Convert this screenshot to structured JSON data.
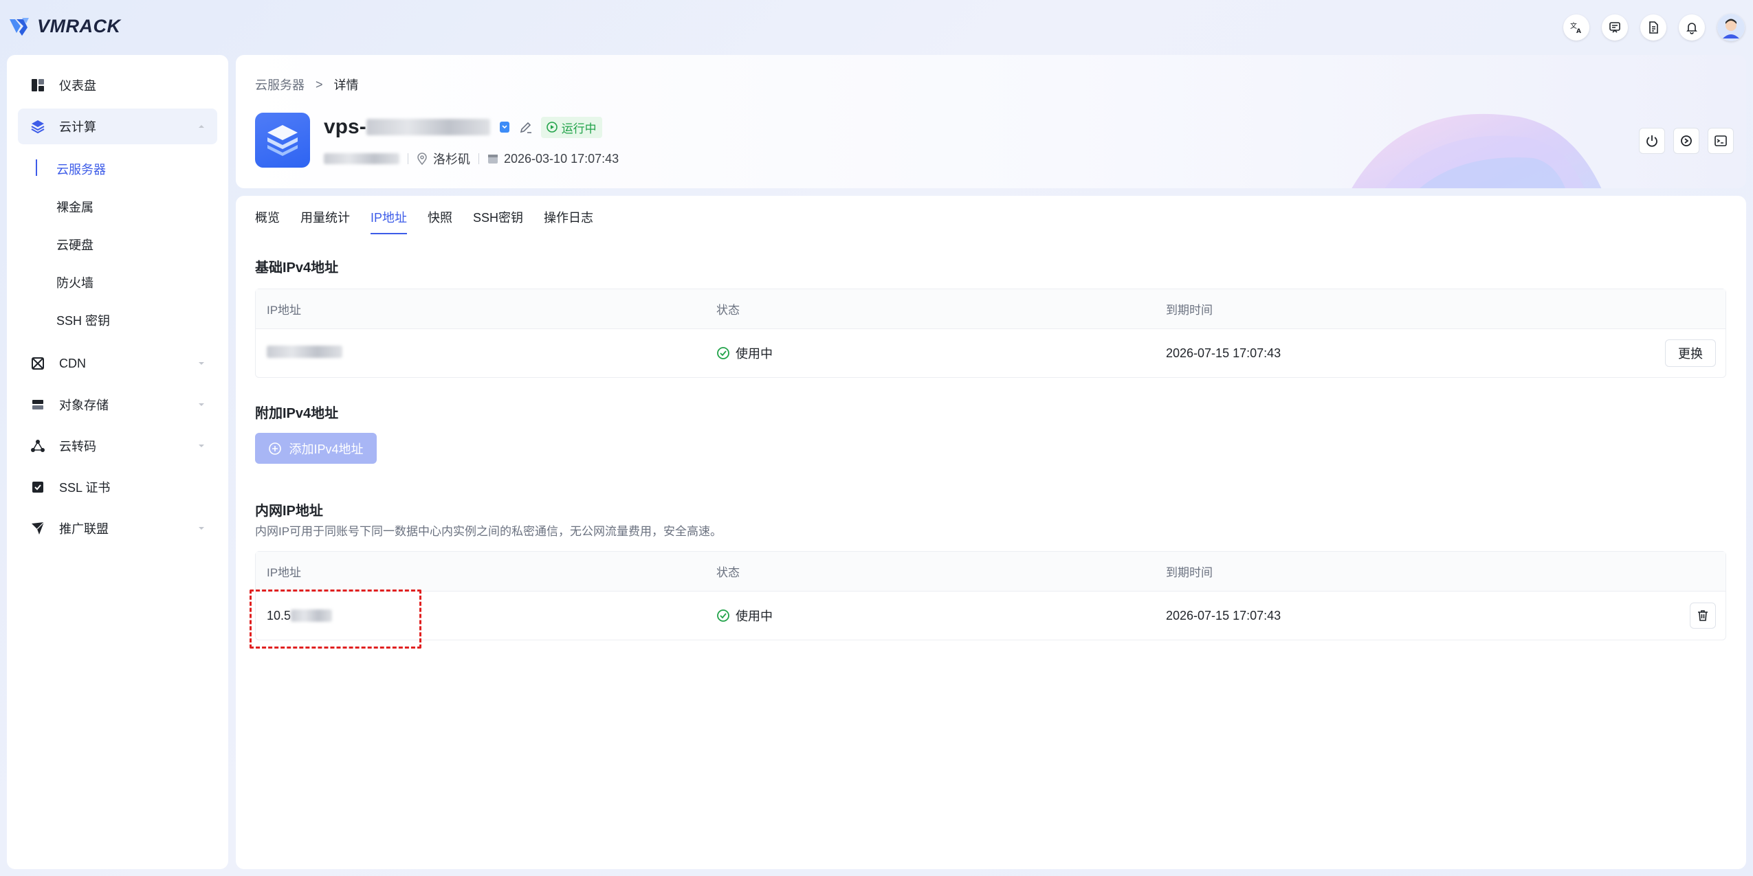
{
  "app": {
    "logo_text": "VMRACK"
  },
  "topbar": {
    "icons": [
      "translate-icon",
      "message-icon",
      "document-icon",
      "bell-icon",
      "avatar"
    ]
  },
  "sidebar": {
    "items": [
      {
        "label": "仪表盘",
        "icon": "dashboard-icon"
      },
      {
        "label": "云计算",
        "icon": "layers-icon",
        "expanded": true,
        "children": [
          "云服务器",
          "裸金属",
          "云硬盘",
          "防火墙",
          "SSH 密钥"
        ],
        "active_child": "云服务器"
      },
      {
        "label": "CDN",
        "icon": "cdn-icon"
      },
      {
        "label": "对象存储",
        "icon": "storage-icon"
      },
      {
        "label": "云转码",
        "icon": "transcode-icon"
      },
      {
        "label": "SSL 证书",
        "icon": "certificate-icon"
      },
      {
        "label": "推广联盟",
        "icon": "paper-plane-icon"
      }
    ]
  },
  "header": {
    "breadcrumb_parent": "云服务器",
    "breadcrumb_separator": ">",
    "breadcrumb_current": "详情",
    "server_name_prefix": "vps-",
    "status": "运行中",
    "location": "洛杉矶",
    "created_at": "2026-03-10 17:07:43",
    "actions": [
      "power-icon",
      "restart-icon",
      "console-icon"
    ]
  },
  "tabs": [
    "概览",
    "用量统计",
    "IP地址",
    "快照",
    "SSH密钥",
    "操作日志"
  ],
  "active_tab": "IP地址",
  "basic_ipv4": {
    "title": "基础IPv4地址",
    "headers": [
      "IP地址",
      "状态",
      "到期时间"
    ],
    "rows": [
      {
        "status": "使用中",
        "expires": "2026-07-15 17:07:43",
        "action": "更换"
      }
    ]
  },
  "extra_ipv4": {
    "title": "附加IPv4地址",
    "add_button": "添加IPv4地址"
  },
  "private_ip": {
    "title": "内网IP地址",
    "description": "内网IP可用于同账号下同一数据中心内实例之间的私密通信，无公网流量费用，安全高速。",
    "headers": [
      "IP地址",
      "状态",
      "到期时间"
    ],
    "rows": [
      {
        "ip_prefix": "10.5",
        "status": "使用中",
        "expires": "2026-07-15 17:07:43"
      }
    ]
  },
  "colors": {
    "accent": "#3d5ce8",
    "success": "#22a34a",
    "highlight": "#e02020"
  }
}
